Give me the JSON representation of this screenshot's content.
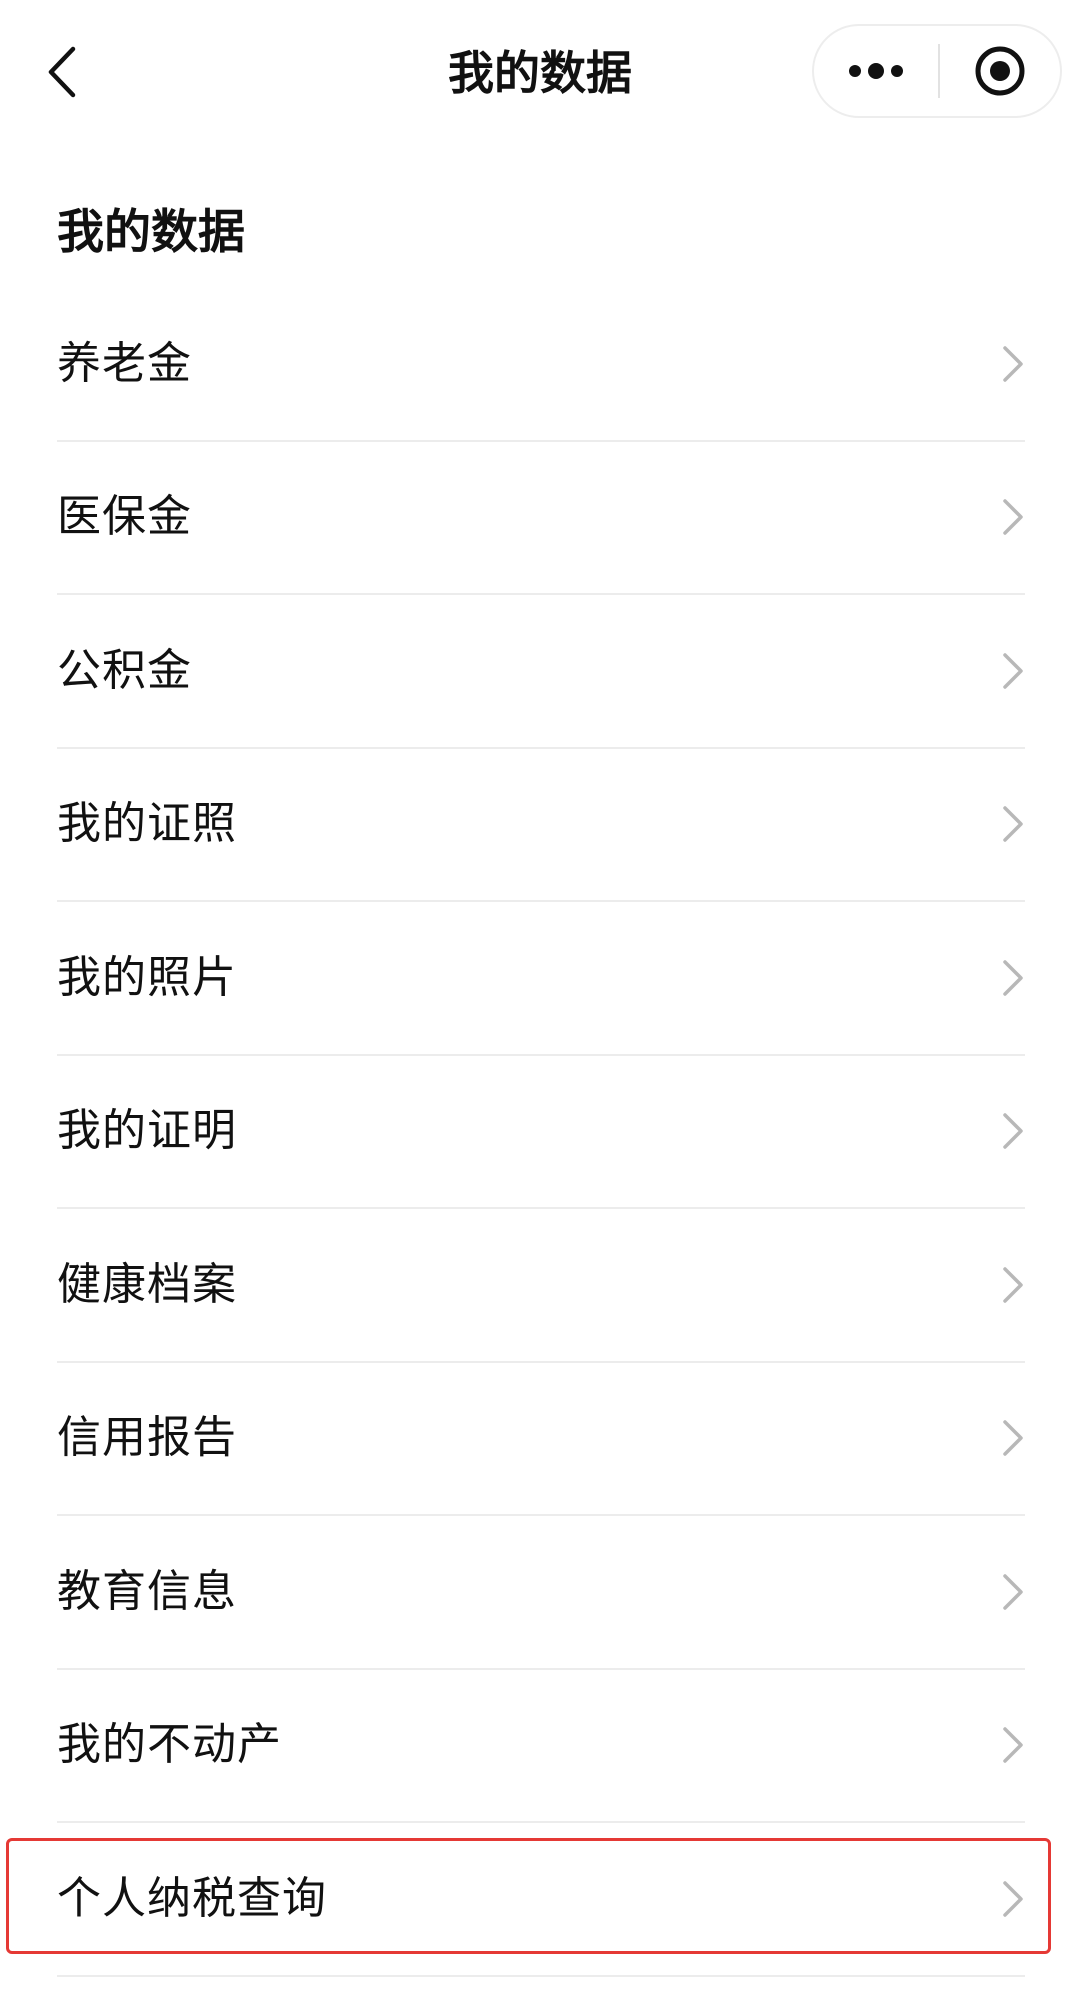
{
  "nav": {
    "title": "我的数据",
    "back_icon": "chevron-left-icon",
    "more_icon": "more-dots-icon",
    "close_icon": "target-circle-icon"
  },
  "section": {
    "title": "我的数据"
  },
  "items": [
    {
      "label": "养老金"
    },
    {
      "label": "医保金"
    },
    {
      "label": "公积金"
    },
    {
      "label": "我的证照"
    },
    {
      "label": "我的照片"
    },
    {
      "label": "我的证明"
    },
    {
      "label": "健康档案"
    },
    {
      "label": "信用报告"
    },
    {
      "label": "教育信息"
    },
    {
      "label": "我的不动产"
    },
    {
      "label": "个人纳税查询",
      "highlighted": true
    }
  ],
  "colors": {
    "highlight_border": "#e53935",
    "divider": "#ececec",
    "chevron": "#b8b8b8",
    "text": "#111111"
  }
}
